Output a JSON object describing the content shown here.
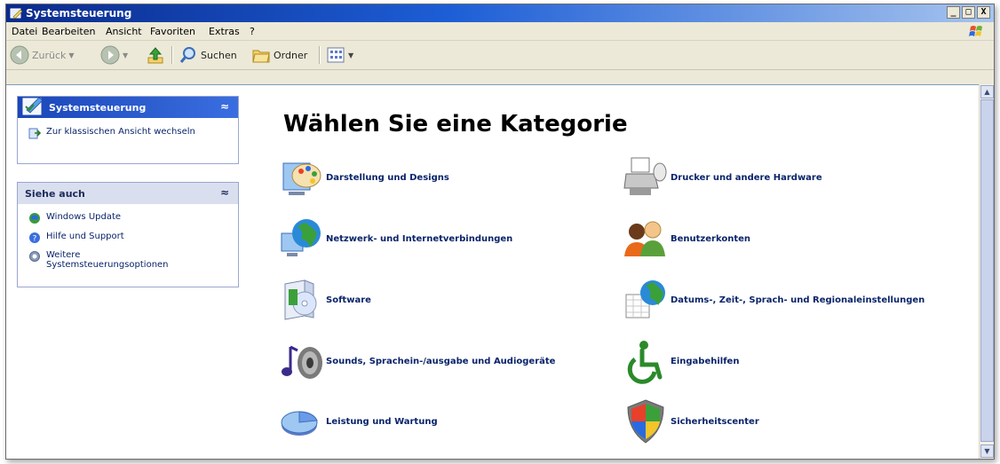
{
  "window": {
    "title": "Systemsteuerung"
  },
  "menubar": [
    "Datei",
    "Bearbeiten",
    "Ansicht",
    "Favoriten",
    "Extras",
    "?"
  ],
  "toolbar": {
    "back": "Zurück",
    "search": "Suchen",
    "folders": "Ordner"
  },
  "left_panel": {
    "panel1": {
      "title": "Systemsteuerung",
      "items": [
        "Zur klassischen Ansicht wechseln"
      ]
    },
    "panel2": {
      "title": "Siehe auch",
      "items": [
        "Windows Update",
        "Hilfe und Support",
        "Weitere",
        "Systemsteuerungsoptionen"
      ]
    }
  },
  "main": {
    "heading": "Wählen Sie eine Kategorie",
    "categories": [
      "Darstellung und Designs",
      "Netzwerk- und Internetverbindungen",
      "Software",
      "Sounds, Sprachein-/ausgabe und Audiogeräte",
      "Leistung und Wartung",
      "Drucker und andere Hardware",
      "Benutzerkonten",
      "Datums-, Zeit-, Sprach- und Regionaleinstellungen",
      "Eingabehilfen",
      "Sicherheitscenter"
    ]
  },
  "icons": {
    "appearance": "paint-palette-icon",
    "network": "globe-network-icon",
    "software": "software-cd-box-icon",
    "sounds": "speaker-note-icon",
    "performance": "pie-chart-icon",
    "printer": "printer-icon",
    "users": "user-accounts-icon",
    "datetime": "globe-calendar-icon",
    "accessibility": "wheelchair-icon",
    "security": "shield-icon"
  }
}
